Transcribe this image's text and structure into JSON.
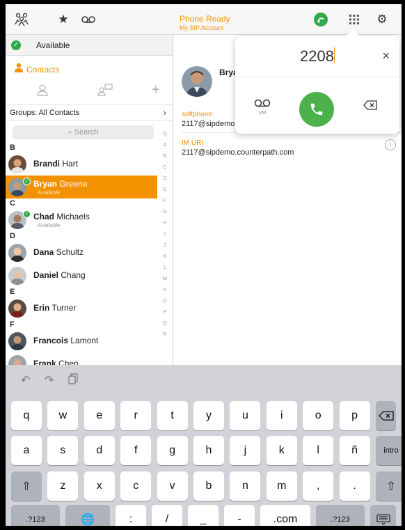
{
  "topbar": {
    "status_title": "Phone Ready",
    "status_subtitle": "My SIP Account",
    "icons": [
      "contacts-group-icon",
      "star-icon",
      "voicemail-icon",
      "connection-icon",
      "dialpad-grid-icon",
      "gear-icon"
    ]
  },
  "presence": {
    "label": "Available",
    "status_color": "#2eaa4a"
  },
  "contacts": {
    "header": "Contacts",
    "groups_label": "Groups: All Contacts",
    "search_placeholder": "Search",
    "index_letters": [
      "Q",
      "A",
      "B",
      "C",
      "D",
      "E",
      "F",
      "G",
      "H",
      "I",
      "J",
      "K",
      "L",
      "M",
      "N",
      "O",
      "P",
      "Q",
      "R"
    ],
    "sections": [
      {
        "letter": "B",
        "items": [
          {
            "first": "Brandi",
            "last": "Hart",
            "status": "",
            "selected": false
          },
          {
            "first": "Bryan",
            "last": "Greene",
            "status": "Available",
            "selected": true
          }
        ]
      },
      {
        "letter": "C",
        "items": [
          {
            "first": "Chad",
            "last": "Michaels",
            "status": "Available",
            "selected": false
          }
        ]
      },
      {
        "letter": "D",
        "items": [
          {
            "first": "Dana",
            "last": "Schultz",
            "status": "",
            "selected": false
          },
          {
            "first": "Daniel",
            "last": "Chang",
            "status": "",
            "selected": false
          }
        ]
      },
      {
        "letter": "E",
        "items": [
          {
            "first": "Erin",
            "last": "Turner",
            "status": "",
            "selected": false
          }
        ]
      },
      {
        "letter": "F",
        "items": [
          {
            "first": "Francois",
            "last": "Lamont",
            "status": "",
            "selected": false
          },
          {
            "first": "Frank",
            "last": "Chen",
            "status": "",
            "selected": false
          }
        ]
      }
    ]
  },
  "detail": {
    "name": "Brya",
    "softphone_label": "softphone",
    "softphone_value": "2117@sipdemo",
    "im_label": "IM URI",
    "im_value": "2117@sipdemo.counterpath.com"
  },
  "dialpad": {
    "number": "2208",
    "vm_label": "VM",
    "close_glyph": "×",
    "call_color": "#4cb14a"
  },
  "keyboard": {
    "row1": [
      "q",
      "w",
      "e",
      "r",
      "t",
      "y",
      "u",
      "i",
      "o",
      "p"
    ],
    "row2": [
      "a",
      "s",
      "d",
      "f",
      "g",
      "h",
      "j",
      "k",
      "l",
      "ñ"
    ],
    "row2_return": "intro",
    "row3": [
      "z",
      "x",
      "c",
      "v",
      "b",
      "n",
      "m",
      ",",
      "."
    ],
    "row4": [
      ".?123",
      ":",
      "/",
      "_",
      "-",
      ".com",
      ".?123"
    ]
  },
  "colors": {
    "accent": "#f39200",
    "keyboard_bg": "#d1d3d9"
  }
}
